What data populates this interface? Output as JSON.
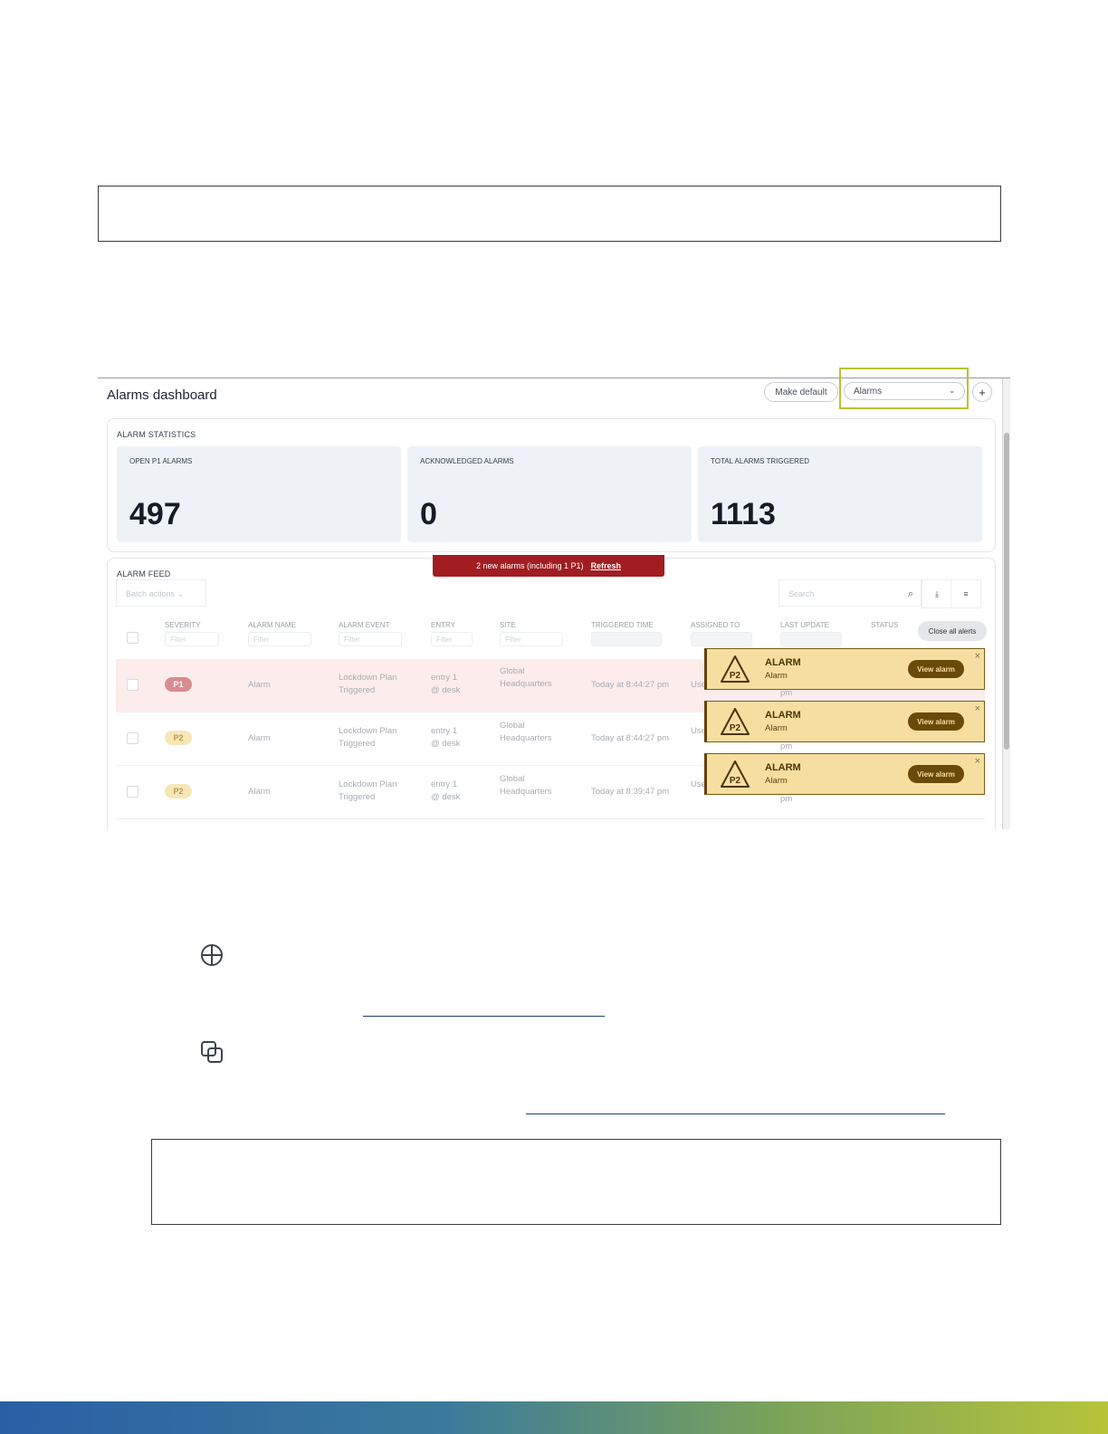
{
  "dashboard": {
    "title": "Alarms dashboard",
    "make_default_label": "Make default",
    "view_select_value": "Alarms",
    "add_label": "+"
  },
  "stats": {
    "section_label": "ALARM STATISTICS",
    "cards": [
      {
        "label": "OPEN P1 ALARMS",
        "value": "497"
      },
      {
        "label": "ACKNOWLEDGED ALARMS",
        "value": "0"
      },
      {
        "label": "TOTAL ALARMS TRIGGERED",
        "value": "1113"
      }
    ]
  },
  "feed": {
    "section_label": "ALARM FEED",
    "banner_text": "2 new alarms (including 1 P1)",
    "banner_link": "Refresh",
    "batch_actions_placeholder": "Batch actions",
    "search_placeholder": "Search",
    "close_all_label": "Close all alerts",
    "columns": [
      "SEVERITY",
      "ALARM NAME",
      "ALARM EVENT",
      "ENTRY",
      "SITE",
      "TRIGGERED TIME",
      "ASSIGNED TO",
      "LAST UPDATE",
      "STATUS"
    ],
    "filter_placeholder": "Filter",
    "rows": [
      {
        "severity": "P1",
        "name": "Alarm",
        "event_line1": "Lockdown Plan",
        "event_line2": "Triggered",
        "entry_line1": "entry 1",
        "entry_line2": "@ desk",
        "site_line1": "Global",
        "site_line2": "Headquarters",
        "time": "Today at 8:44:27 pm",
        "assigned": "Use"
      },
      {
        "severity": "P2",
        "name": "Alarm",
        "event_line1": "Lockdown Plan",
        "event_line2": "Triggered",
        "entry_line1": "entry 1",
        "entry_line2": "@ desk",
        "site_line1": "Global",
        "site_line2": "Headquarters",
        "time": "Today at 8:44:27 pm",
        "assigned": "Use"
      },
      {
        "severity": "P2",
        "name": "Alarm",
        "event_line1": "Lockdown Plan",
        "event_line2": "Triggered",
        "entry_line1": "entry 1",
        "entry_line2": "@ desk",
        "site_line1": "Global",
        "site_line2": "Headquarters",
        "time": "Today at 8:39:47 pm",
        "assigned": "Use"
      }
    ],
    "last_update_fragment": "pm"
  },
  "toasts": [
    {
      "badge": "P2",
      "title": "ALARM",
      "subtitle": "Alarm",
      "button": "View alarm",
      "close": "×"
    },
    {
      "badge": "P2",
      "title": "ALARM",
      "subtitle": "Alarm",
      "button": "View alarm",
      "close": "×"
    },
    {
      "badge": "P2",
      "title": "ALARM",
      "subtitle": "Alarm",
      "button": "View alarm",
      "close": "×"
    }
  ],
  "colors": {
    "banner": "#a11d22",
    "toast_bg": "#f6dea0",
    "highlight": "#b9c32f",
    "p1_bg": "#d98c8f",
    "p2_bg": "#f7e6b6"
  },
  "icons": [
    "globe-icon",
    "copy-icon"
  ]
}
